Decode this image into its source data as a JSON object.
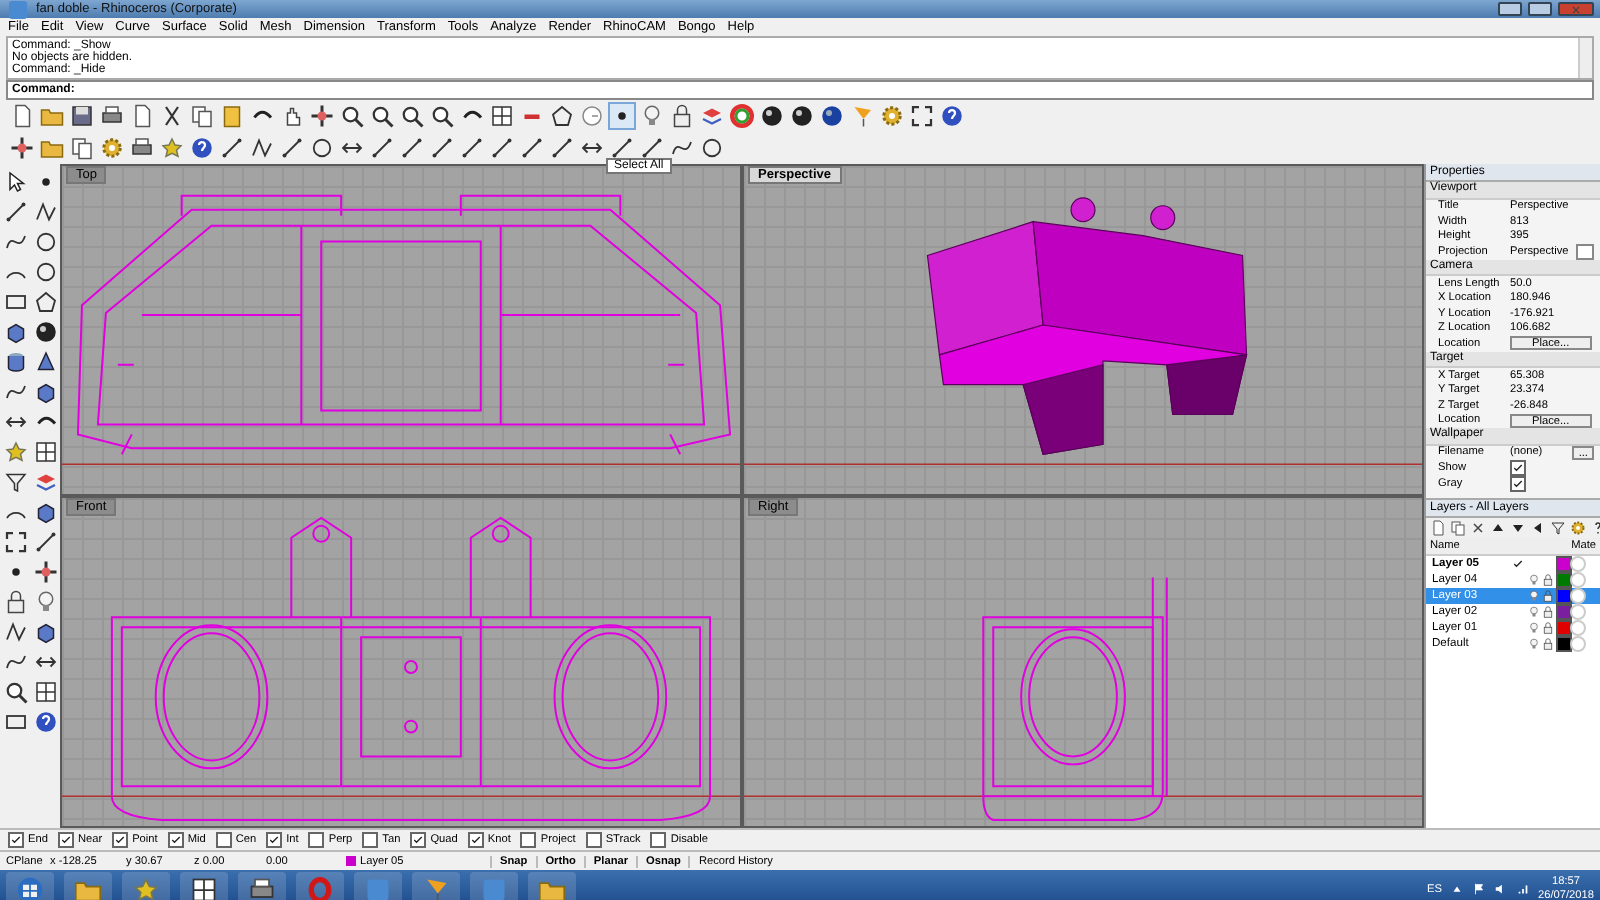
{
  "window": {
    "title": "fan doble - Rhinoceros (Corporate)"
  },
  "menu": [
    "File",
    "Edit",
    "View",
    "Curve",
    "Surface",
    "Solid",
    "Mesh",
    "Dimension",
    "Transform",
    "Tools",
    "Analyze",
    "Render",
    "RhinoCAM",
    "Bongo",
    "Help"
  ],
  "command_history": [
    "Command: _Show",
    "No objects are hidden.",
    "Command: _Hide"
  ],
  "command_prompt": "Command:",
  "tooltip": "Select All",
  "viewports": [
    {
      "title": "Top",
      "kind": "top",
      "selected": false
    },
    {
      "title": "Perspective",
      "kind": "perspective",
      "selected": true
    },
    {
      "title": "Front",
      "kind": "front",
      "selected": false
    },
    {
      "title": "Right",
      "kind": "right",
      "selected": false
    }
  ],
  "properties": {
    "title": "Properties",
    "sections": [
      {
        "heading": "Viewport",
        "rows": [
          {
            "label": "Title",
            "kind": "text",
            "value": "Perspective"
          },
          {
            "label": "Width",
            "kind": "text",
            "value": "813"
          },
          {
            "label": "Height",
            "kind": "text",
            "value": "395"
          },
          {
            "label": "Projection",
            "kind": "dropdown",
            "value": "Perspective"
          }
        ]
      },
      {
        "heading": "Camera",
        "rows": [
          {
            "label": "Lens Length",
            "kind": "text",
            "value": "50.0"
          },
          {
            "label": "X Location",
            "kind": "text",
            "value": "180.946"
          },
          {
            "label": "Y Location",
            "kind": "text",
            "value": "-176.921"
          },
          {
            "label": "Z Location",
            "kind": "text",
            "value": "106.682"
          },
          {
            "label": "Location",
            "kind": "button",
            "value": "Place..."
          }
        ]
      },
      {
        "heading": "Target",
        "rows": [
          {
            "label": "X Target",
            "kind": "text",
            "value": "65.308"
          },
          {
            "label": "Y Target",
            "kind": "text",
            "value": "23.374"
          },
          {
            "label": "Z Target",
            "kind": "text",
            "value": "-26.848"
          },
          {
            "label": "Location",
            "kind": "button",
            "value": "Place..."
          }
        ]
      },
      {
        "heading": "Wallpaper",
        "rows": [
          {
            "label": "Filename",
            "kind": "browse",
            "value": "(none)",
            "button": "..."
          },
          {
            "label": "Show",
            "kind": "checkbox",
            "checked": true
          },
          {
            "label": "Gray",
            "kind": "checkbox",
            "checked": true
          }
        ]
      }
    ]
  },
  "layers": {
    "title": "Layers - All Layers",
    "columns": [
      "Name",
      "Mate"
    ],
    "rows": [
      {
        "name": "Layer 05",
        "current": true,
        "selected": false,
        "color": "#cc00cc"
      },
      {
        "name": "Layer 04",
        "current": false,
        "selected": false,
        "color": "#007a00"
      },
      {
        "name": "Layer 03",
        "current": false,
        "selected": true,
        "color": "#0000ff"
      },
      {
        "name": "Layer 02",
        "current": false,
        "selected": false,
        "color": "#7a1fa0"
      },
      {
        "name": "Layer 01",
        "current": false,
        "selected": false,
        "color": "#e00000"
      },
      {
        "name": "Default",
        "current": false,
        "selected": false,
        "color": "#000000"
      }
    ]
  },
  "osnaps": [
    {
      "label": "End",
      "checked": true
    },
    {
      "label": "Near",
      "checked": true
    },
    {
      "label": "Point",
      "checked": true
    },
    {
      "label": "Mid",
      "checked": true
    },
    {
      "label": "Cen",
      "checked": false
    },
    {
      "label": "Int",
      "checked": true
    },
    {
      "label": "Perp",
      "checked": false
    },
    {
      "label": "Tan",
      "checked": false
    },
    {
      "label": "Quad",
      "checked": true
    },
    {
      "label": "Knot",
      "checked": true
    },
    {
      "label": "Project",
      "checked": false
    },
    {
      "label": "STrack",
      "checked": false
    },
    {
      "label": "Disable",
      "checked": false
    }
  ],
  "status": {
    "cplane": "CPlane",
    "x": "x -128.25",
    "y": "y 30.67",
    "z": "z 0.00",
    "distance": "0.00",
    "layer": {
      "name": "Layer 05",
      "color": "#cc00cc"
    },
    "toggles": [
      {
        "label": "Snap",
        "on": true
      },
      {
        "label": "Ortho",
        "on": true
      },
      {
        "label": "Planar",
        "on": true
      },
      {
        "label": "Osnap",
        "on": true
      },
      {
        "label": "Record History",
        "on": false
      }
    ]
  },
  "taskbar": {
    "language": "ES",
    "time": "18:57",
    "date": "26/07/2018"
  }
}
